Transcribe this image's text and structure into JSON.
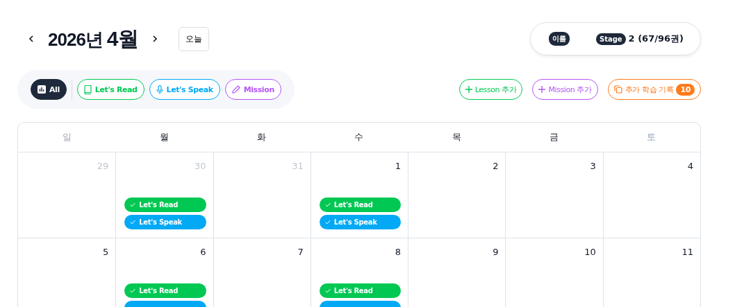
{
  "header": {
    "year_month": "2026년",
    "month": "4월",
    "today_button": "오늘"
  },
  "profile": {
    "name_badge": "이름",
    "stage_badge": "Stage",
    "stage_value": "2 (67/96권)"
  },
  "filters": [
    {
      "label": "All",
      "kind": "all",
      "selected": true
    },
    {
      "label": "Let's Read",
      "kind": "read",
      "selected": false
    },
    {
      "label": "Let's Speak",
      "kind": "speak",
      "selected": false
    },
    {
      "label": "Mission",
      "kind": "mission",
      "selected": false
    }
  ],
  "actions": [
    {
      "label": "Lesson 추가",
      "kind": "lesson"
    },
    {
      "label": "Mission 추가",
      "kind": "mission"
    },
    {
      "label": "추가 학습 기록",
      "kind": "record",
      "count": "10"
    }
  ],
  "weekdays": [
    {
      "label": "일",
      "kind": "sun"
    },
    {
      "label": "월",
      "kind": "day"
    },
    {
      "label": "화",
      "kind": "day"
    },
    {
      "label": "수",
      "kind": "day"
    },
    {
      "label": "목",
      "kind": "day"
    },
    {
      "label": "금",
      "kind": "day"
    },
    {
      "label": "토",
      "kind": "sat"
    }
  ],
  "weeks": [
    [
      {
        "date": "29",
        "outside": true
      },
      {
        "date": "30",
        "outside": true,
        "events": [
          {
            "label": "Let's Read",
            "kind": "read"
          },
          {
            "label": "Let's Speak",
            "kind": "speak"
          }
        ]
      },
      {
        "date": "31",
        "outside": true
      },
      {
        "date": "1",
        "outside": false,
        "events": [
          {
            "label": "Let's Read",
            "kind": "read"
          },
          {
            "label": "Let's Speak",
            "kind": "speak"
          }
        ]
      },
      {
        "date": "2",
        "outside": false
      },
      {
        "date": "3",
        "outside": false
      },
      {
        "date": "4",
        "outside": false
      }
    ],
    [
      {
        "date": "5",
        "outside": false
      },
      {
        "date": "6",
        "outside": false,
        "events": [
          {
            "label": "Let's Read",
            "kind": "read"
          },
          {
            "kind": "speak"
          }
        ]
      },
      {
        "date": "7",
        "outside": false
      },
      {
        "date": "8",
        "outside": false,
        "events": [
          {
            "label": "Let's Read",
            "kind": "read"
          },
          {
            "kind": "speak"
          }
        ]
      },
      {
        "date": "9",
        "outside": false
      },
      {
        "date": "10",
        "outside": false
      },
      {
        "date": "11",
        "outside": false
      }
    ]
  ]
}
